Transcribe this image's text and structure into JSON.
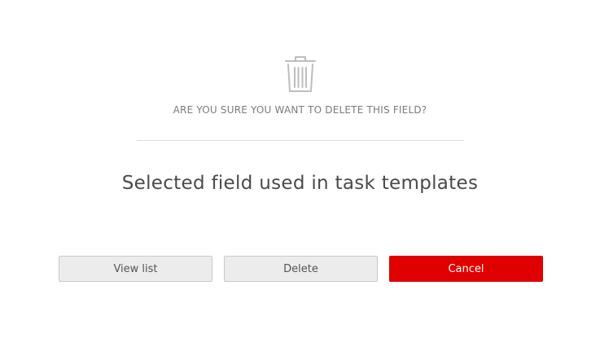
{
  "dialog": {
    "icon": "trash-icon",
    "question": "ARE YOU SURE YOU WANT TO DELETE THIS FIELD?",
    "message": "Selected field used in task templates"
  },
  "buttons": {
    "view_list_label": "View list",
    "delete_label": "Delete",
    "cancel_label": "Cancel"
  },
  "colors": {
    "accent": "#e00000",
    "secondary_button_bg": "#ececec",
    "text_muted": "#7b7b7b"
  }
}
